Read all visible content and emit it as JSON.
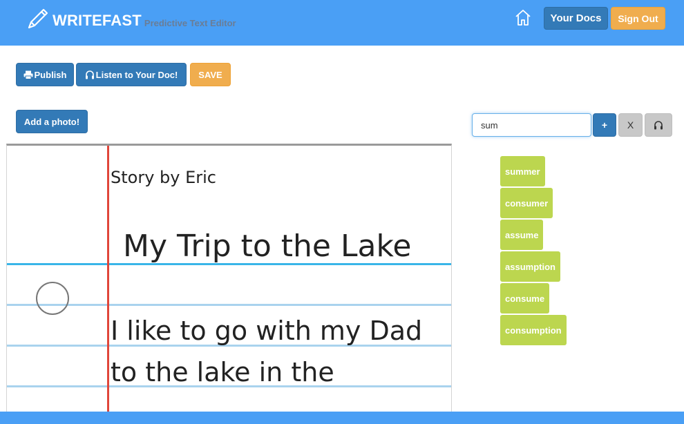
{
  "header": {
    "brand": "WRITEFAST",
    "tagline": "Predictive Text Editor",
    "your_docs": "Your Docs",
    "sign_out": "Sign Out"
  },
  "toolbar": {
    "publish": "Publish",
    "listen": "Listen to Your Doc!",
    "save": "SAVE",
    "add_photo": "Add a photo!"
  },
  "suggest": {
    "query": "sum",
    "add_label": "+",
    "clear_label": "X",
    "suggestions": [
      "summer",
      "consumer",
      "assume",
      "assumption",
      "consume",
      "consumption"
    ]
  },
  "document": {
    "byline": "Story by Eric",
    "title": "My Trip to the Lake",
    "lines": [
      "I like to go with my Dad",
      "to the lake in the"
    ]
  },
  "colors": {
    "navbar": "#4a9ff5",
    "primary": "#337ab7",
    "warning": "#f0ad4e",
    "suggestion": "#bcd64f",
    "margin_line": "#e0463a",
    "rule_line": "#39b5e8"
  }
}
